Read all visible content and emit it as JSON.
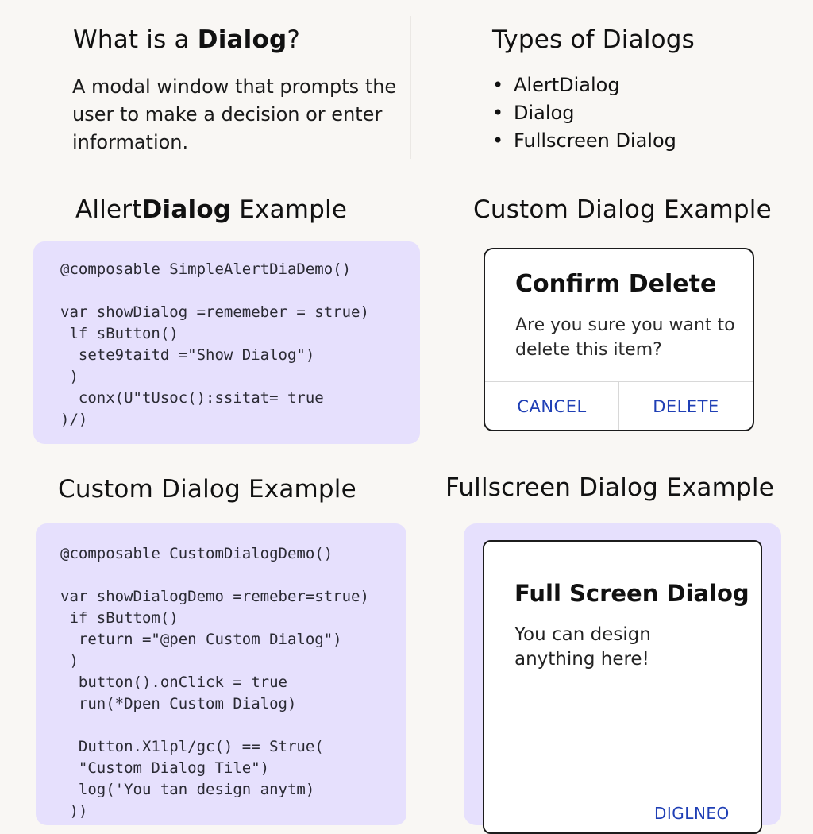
{
  "what_is": {
    "heading_prefix": "What is a ",
    "heading_bold": "Dialog",
    "heading_suffix": "?",
    "description": "A modal window that prompts the user to make a decision or enter information."
  },
  "types": {
    "heading": "Types of Dialogs",
    "items": [
      "AlertDialog",
      "Dialog",
      "Fullscreen Dialog"
    ]
  },
  "alert_example": {
    "heading_prefix": "Allert",
    "heading_bold": "Dialog",
    "heading_suffix": " Example",
    "code": [
      "@composable SimpleAlertDiaDemo()",
      "",
      "var showDialog =rememeber = strue)",
      " lf sButton()",
      "  sete9taitd =\"Show Dialog\")",
      " )",
      "  conx(U\"tUsoc():ssitat= true",
      ")/)"
    ]
  },
  "custom_preview": {
    "heading": "Custom Dialog Example",
    "title": "Confirm Delete",
    "message": "Are you sure you want to delete this item?",
    "cancel_label": "CANCEL",
    "delete_label": "DELETE"
  },
  "custom_code": {
    "heading": "Custom Dialog Example",
    "code": [
      "@composable CustomDialogDemo()",
      "",
      "var showDialogDemo =remeber=strue)",
      " if sButtom()",
      "  return =\"@pen Custom Dialog\")",
      " )",
      "  button().onClick = true",
      "  run(*Dpen Custom Dialog)",
      "",
      "  Dutton.X1lpl/gc() == Strue(",
      "  \"Custom Dialog Tile\")",
      "  log('You tan design anytm)",
      " ))"
    ]
  },
  "fullscreen": {
    "heading": "Fullscreen Dialog Example",
    "title": "Full Screen Dialog",
    "message": "You can design anything here!",
    "action_label": "DIGLNEO"
  }
}
